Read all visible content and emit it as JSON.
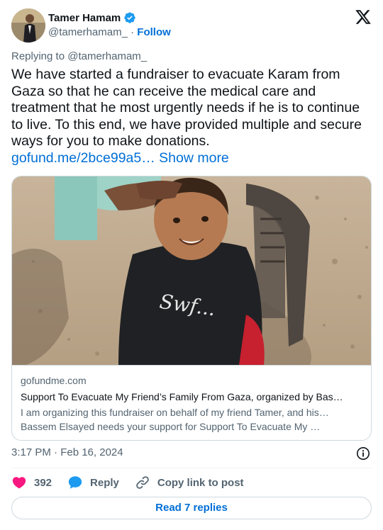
{
  "author": {
    "name": "Tamer Hamam",
    "handle": "@tamerhamam_",
    "separator": "·",
    "follow_label": "Follow"
  },
  "replying_to": "Replying to @tamerhamam_",
  "tweet": {
    "text": "We have started a fundraiser to evacuate Karam from Gaza so that he can receive the medical care and treatment that he most urgently needs if he is to continue to live. To this end, we have provided multiple and secure ways for you to make donations.",
    "link": "gofund.me/2bce99a5…",
    "show_more": "Show more"
  },
  "card": {
    "domain": "gofundme.com",
    "title": "Support To Evacuate My Friend’s Family From Gaza, organized by Bas…",
    "desc_line1": "I am organizing this fundraiser on behalf of my friend Tamer, and his…",
    "desc_line2": "Bassem Elsayed needs your support for Support To Evacuate My …",
    "shirt_text": "Swf..."
  },
  "timestamp": "3:17 PM · Feb 16, 2024",
  "actions": {
    "like_count": "392",
    "reply_label": "Reply",
    "copy_label": "Copy link to post"
  },
  "read_replies": "Read 7 replies",
  "colors": {
    "link": "#006fd6",
    "like": "#f91880",
    "reply_icon": "#1d9bf0",
    "muted": "#536471"
  },
  "icons": [
    "verified-badge-icon",
    "x-logo-icon",
    "info-icon",
    "heart-icon",
    "reply-bubble-icon",
    "link-icon"
  ]
}
